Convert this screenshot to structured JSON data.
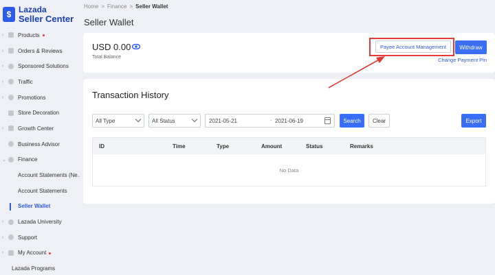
{
  "logo": {
    "line1": "Lazada",
    "line2": "Seller Center",
    "badge": "$"
  },
  "sidebar": {
    "items": [
      {
        "label": "Products",
        "dot": true
      },
      {
        "label": "Orders & Reviews"
      },
      {
        "label": "Sponsored Solutions"
      },
      {
        "label": "Traffic"
      },
      {
        "label": "Promotions"
      },
      {
        "label": "Store Decoration"
      },
      {
        "label": "Growth Center"
      },
      {
        "label": "Business Advisor"
      },
      {
        "label": "Finance"
      },
      {
        "label": "Account Statements (Ne..."
      },
      {
        "label": "Account Statements"
      },
      {
        "label": "Seller Wallet"
      },
      {
        "label": "Lazada University"
      },
      {
        "label": "Support"
      },
      {
        "label": "My Account",
        "dot": true
      },
      {
        "label": "Lazada Programs"
      }
    ]
  },
  "breadcrumb": {
    "home": "Home",
    "finance": "Finance",
    "current": "Seller Wallet",
    "sep": ">"
  },
  "page": {
    "title": "Seller Wallet"
  },
  "balance": {
    "amount": "USD 0.00",
    "label": "Total Balance",
    "payee_button": "Payee Account Management",
    "withdraw_button": "Withdraw",
    "change_pin": "Change Payment Pin"
  },
  "transactions": {
    "title": "Transaction History",
    "type_select": "All Type",
    "status_select": "All Status",
    "date_start": "2021-05-21",
    "date_sep": "-",
    "date_end": "2021-06-19",
    "search_button": "Search",
    "clear_button": "Clear",
    "export_button": "Export",
    "columns": [
      "ID",
      "Time",
      "Type",
      "Amount",
      "Status",
      "Remarks"
    ],
    "empty_text": "No Data"
  },
  "colors": {
    "accent": "#3b6ef6",
    "highlight": "#e53935",
    "brand": "#1a3fb5"
  }
}
